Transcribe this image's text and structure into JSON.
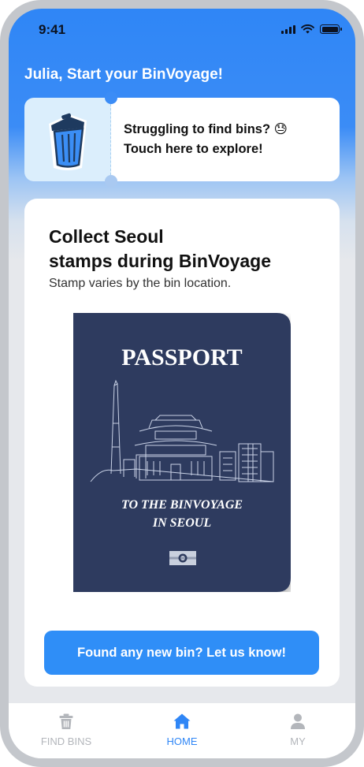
{
  "status_bar": {
    "time": "9:41",
    "icons": [
      "cellular-signal-icon",
      "wifi-icon",
      "battery-icon"
    ]
  },
  "header": {
    "greeting": "Julia, Start your BinVoyage!"
  },
  "find_bins_card": {
    "line1": "Struggling to find bins? 😓",
    "line2": "Touch here to explore!",
    "icon": "trash-bin-icon"
  },
  "stamp_card": {
    "title_line1": "Collect Seoul",
    "title_line2": "stamps during BinVoyage",
    "subtitle": "Stamp varies by the bin location.",
    "passport": {
      "title": "PASSPORT",
      "line1": "TO THE BINVOYAGE",
      "line2": "IN SEOUL"
    },
    "cta_label": "Found any new bin? Let us know!"
  },
  "tab_bar": {
    "tabs": [
      {
        "label": "FIND BINS",
        "icon": "trash-icon",
        "active": false
      },
      {
        "label": "HOME",
        "icon": "home-icon",
        "active": true
      },
      {
        "label": "MY",
        "icon": "user-icon",
        "active": false
      }
    ]
  },
  "colors": {
    "primary": "#2f86f6",
    "button": "#2f8ef7",
    "passport_cover": "#2e3b5e",
    "tab_inactive": "#b3b6bb",
    "background": "#e6e8ec"
  }
}
